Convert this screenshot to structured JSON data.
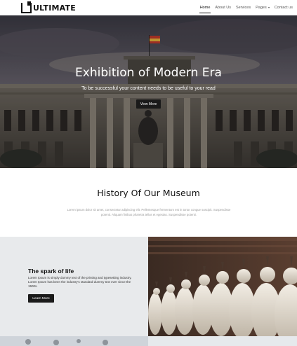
{
  "brand": {
    "letter": "U",
    "name": "ULTIMATE"
  },
  "nav": {
    "home": "Home",
    "about": "About Us",
    "services": "Services",
    "pages": "Pages",
    "contact": "Contact us"
  },
  "hero": {
    "title": "Exhibition of Modern Era",
    "subtitle": "To be successful your content needs to be useful to your read",
    "button": "View More"
  },
  "history": {
    "title": "History Of Our Museum",
    "text": "Lorem ipsum dolor sit amet, consectetur adipiscing elit. Pellentesque fermentum est in tortor congue suscipit. Suspendisse potenti. Aliquam finibus pharetra tellus et egestas. Suspendisse potenti."
  },
  "spark": {
    "title": "The spark of life",
    "text": "Lorem Ipsum is simply dummy text of the printing and typesetting industry. Lorem Ipsum has been the industry's standard dummy text ever since the 1500s.",
    "button": "Learn More"
  },
  "colors": {
    "dark_button": "#1a1a1a",
    "panel_gray": "#e8eaec"
  }
}
